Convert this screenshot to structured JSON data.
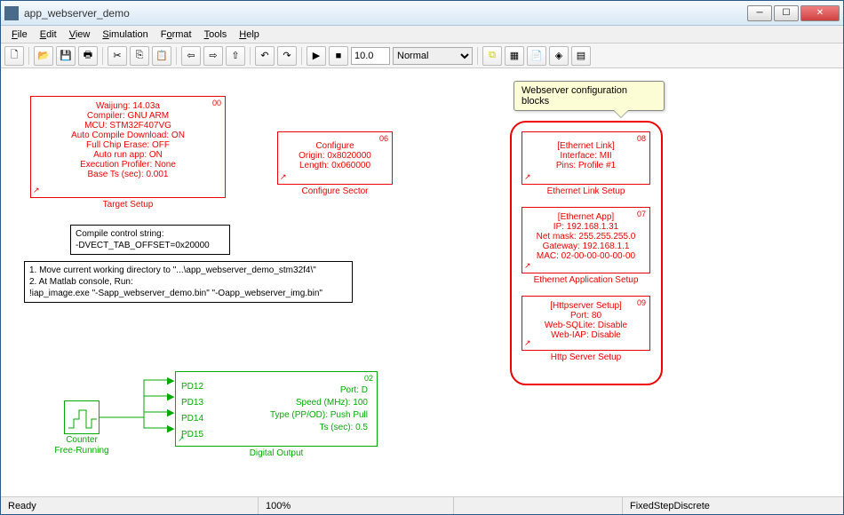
{
  "window": {
    "title": "app_webserver_demo"
  },
  "menu": [
    "File",
    "Edit",
    "View",
    "Simulation",
    "Format",
    "Tools",
    "Help"
  ],
  "toolbar": {
    "time": "10.0",
    "mode": "Normal"
  },
  "tooltip": "Webserver configuration blocks",
  "targetSetup": {
    "tag": "00",
    "lines": [
      "Waijung: 14.03a",
      "Compiler: GNU ARM",
      "MCU: STM32F407VG",
      "Auto Compile Download: ON",
      "Full Chip Erase: OFF",
      "Auto run app: ON",
      "Execution Profiler: None",
      "Base Ts (sec): 0.001"
    ],
    "label": "Target Setup"
  },
  "configureSector": {
    "tag": "06",
    "lines": [
      "Configure",
      "Origin: 0x8020000",
      "Length: 0x060000"
    ],
    "label": "Configure Sector"
  },
  "ethLink": {
    "tag": "08",
    "lines": [
      "[Ethernet Link]",
      "Interface: MII",
      "Pins: Profile #1"
    ],
    "label": "Ethernet Link Setup"
  },
  "ethApp": {
    "tag": "07",
    "lines": [
      "[Ethernet App]",
      "IP: 192.168.1.31",
      "Net mask: 255.255.255.0",
      "Gateway: 192.168.1.1",
      "MAC: 02-00-00-00-00-00"
    ],
    "label": "Ethernet Application Setup"
  },
  "httpServer": {
    "tag": "09",
    "lines": [
      "[Httpserver Setup]",
      "Port: 80",
      "Web-SQLite: Disable",
      "Web-IAP: Disable"
    ],
    "label": "Http Server Setup"
  },
  "compileBox": "Compile control string:\n-DVECT_TAB_OFFSET=0x20000",
  "instructBox": "1. Move current working directory to \"...\\app_webserver_demo_stm32f4\\\"\n2. At Matlab console, Run:\n!iap_image.exe \"-Sapp_webserver_demo.bin\" \"-Oapp_webserver_img.bin\"",
  "digitalOutput": {
    "tag": "02",
    "ports": [
      "PD12",
      "PD13",
      "PD14",
      "PD15"
    ],
    "lines": [
      "Port: D",
      "Speed (MHz): 100",
      "Type (PP/OD): Push Pull",
      "Ts (sec): 0.5"
    ],
    "label": "Digital Output"
  },
  "counter": {
    "label1": "Counter",
    "label2": "Free-Running"
  },
  "status": {
    "ready": "Ready",
    "pct": "100%",
    "solver": "FixedStepDiscrete"
  }
}
